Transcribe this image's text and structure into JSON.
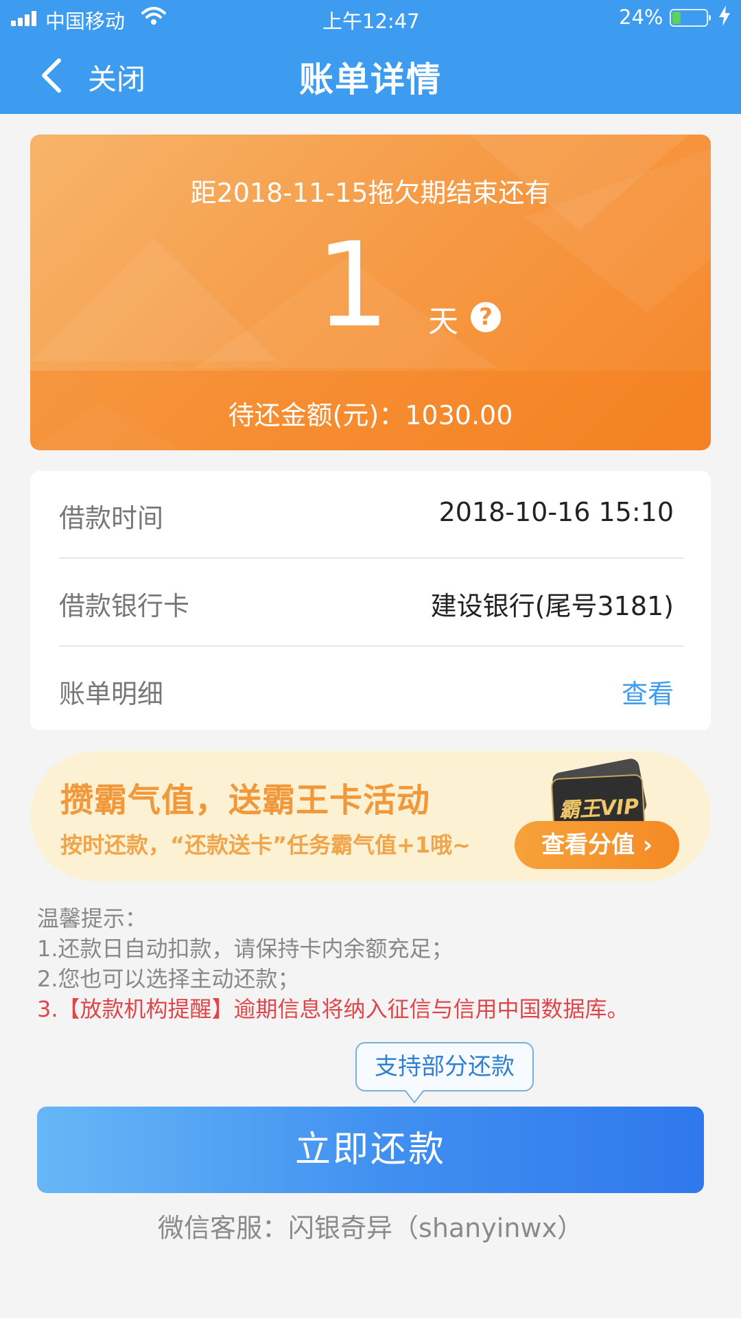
{
  "status_bar": {
    "carrier": "中国移动",
    "time": "上午12:47",
    "battery": "24%",
    "battery_level": 0.24,
    "icons": [
      "signal-icon",
      "wifi-icon",
      "battery-icon",
      "charging-icon"
    ]
  },
  "nav": {
    "back_icon": "chevron-left-icon",
    "close_label": "关闭",
    "title": "账单详情"
  },
  "due_card": {
    "countdown_text": "距2018-11-15拖欠期结束还有",
    "days": "1",
    "days_unit": "天",
    "help_icon": "?",
    "amount_text": "待还金额(元)：1030.00",
    "colors": {
      "start": "#f7b46a",
      "end": "#f5862a"
    }
  },
  "info": {
    "rows": [
      {
        "label": "借款时间",
        "value": "2018-10-16 15:10"
      },
      {
        "label": "借款银行卡",
        "value": "建设银行(尾号3181)"
      },
      {
        "label": "账单明细",
        "value": "查看"
      }
    ]
  },
  "promo": {
    "title": "攒霸气值，送霸王卡活动",
    "subtitle": "按时还款，“还款送卡”任务霸气值+1哦~",
    "vip_label": "霸王VIP",
    "button": "查看分值 ›"
  },
  "tips": {
    "heading": "温馨提示：",
    "lines": [
      "1.还款日自动扣款，请保持卡内余额充足；",
      "2.您也可以选择主动还款；"
    ],
    "warning": "3.【放款机构提醒】逾期信息将纳入征信与信用中国数据库。"
  },
  "tooltip": "支持部分还款",
  "repay_button": "立即还款",
  "service": "微信客服：闪银奇异（shanyinwx）",
  "colors": {
    "header_blue": "#3d9cf0",
    "link_blue": "#3d9cf0",
    "warning_red": "#e0454a",
    "promo_orange": "#f0983a"
  }
}
